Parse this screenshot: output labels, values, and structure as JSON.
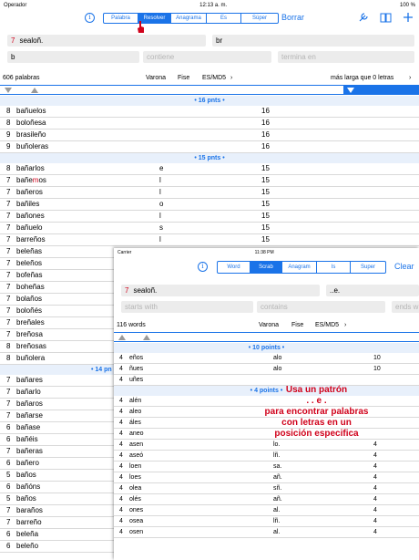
{
  "back": {
    "status": {
      "carrier": "Operador",
      "time": "12:13 a. m.",
      "battery": "100 %"
    },
    "nav": {
      "segments": [
        "Palabra",
        "Resolver",
        "Anagrama",
        "Es",
        "Súper"
      ],
      "active": 1,
      "right_link": "Borrar"
    },
    "inputs": {
      "letters_num": "7",
      "letters": "sealoñ.",
      "contains_letters": "br",
      "starts_with": "b",
      "contains_ph": "contiene",
      "ends_with_ph": "termina en"
    },
    "header": {
      "count": "606 palabras",
      "dict1": "Varona",
      "dict2": "Fise",
      "dict3": "ES/MD5",
      "longest": "más larga que 0 letras"
    },
    "sections": [
      {
        "title": "• 16 pnts •",
        "rows": [
          {
            "n": "8",
            "pre": "",
            "red": "",
            "post": "bañuelos",
            "x": "",
            "p": "16"
          },
          {
            "n": "8",
            "pre": "",
            "red": "",
            "post": "boloñesa",
            "x": "",
            "p": "16"
          },
          {
            "n": "9",
            "pre": "",
            "red": "",
            "post": "brasileño",
            "x": "",
            "p": "16"
          },
          {
            "n": "9",
            "pre": "",
            "red": "",
            "post": "buñoleras",
            "x": "",
            "p": "16"
          }
        ]
      },
      {
        "title": "• 15 pnts •",
        "rows": [
          {
            "n": "8",
            "pre": "bañarl",
            "red": "",
            "post": "os",
            "x": "e",
            "p": "15"
          },
          {
            "n": "7",
            "pre": "bañe",
            "red": "m",
            "post": "os",
            "x": "l",
            "p": "15"
          },
          {
            "n": "7",
            "pre": "bañer",
            "red": "",
            "post": "os",
            "x": "l",
            "p": "15"
          },
          {
            "n": "7",
            "pre": "bañil",
            "red": "",
            "post": "es",
            "x": "o",
            "p": "15"
          },
          {
            "n": "7",
            "pre": "bañon",
            "red": "",
            "post": "es",
            "x": "l",
            "p": "15"
          },
          {
            "n": "7",
            "pre": "bañue",
            "red": "",
            "post": "lo",
            "x": "s",
            "p": "15"
          },
          {
            "n": "7",
            "pre": "barre",
            "red": "",
            "post": "ños",
            "x": "l",
            "p": "15"
          },
          {
            "n": "7",
            "pre": "",
            "red": "",
            "post": "beleñas",
            "x": "",
            "p": ""
          },
          {
            "n": "7",
            "pre": "",
            "red": "",
            "post": "beleños",
            "x": "",
            "p": ""
          },
          {
            "n": "7",
            "pre": "",
            "red": "",
            "post": "bofeñas",
            "x": "",
            "p": ""
          },
          {
            "n": "7",
            "pre": "",
            "red": "",
            "post": "boheñas",
            "x": "",
            "p": ""
          },
          {
            "n": "7",
            "pre": "",
            "red": "",
            "post": "bolaños",
            "x": "",
            "p": ""
          },
          {
            "n": "7",
            "pre": "",
            "red": "",
            "post": "boloñés",
            "x": "",
            "p": ""
          },
          {
            "n": "7",
            "pre": "",
            "red": "",
            "post": "breñales",
            "x": "",
            "p": ""
          },
          {
            "n": "7",
            "pre": "",
            "red": "",
            "post": "breñosa",
            "x": "",
            "p": ""
          },
          {
            "n": "8",
            "pre": "",
            "red": "",
            "post": "breñosas",
            "x": "",
            "p": ""
          },
          {
            "n": "8",
            "pre": "",
            "red": "",
            "post": "buñolera",
            "x": "",
            "p": ""
          }
        ]
      },
      {
        "title": "• 14 pn",
        "rows": [
          {
            "n": "7",
            "pre": "",
            "red": "",
            "post": "bañares",
            "x": "",
            "p": ""
          },
          {
            "n": "7",
            "pre": "",
            "red": "",
            "post": "bañarlo",
            "x": "",
            "p": ""
          },
          {
            "n": "7",
            "pre": "",
            "red": "",
            "post": "bañaros",
            "x": "",
            "p": ""
          },
          {
            "n": "7",
            "pre": "",
            "red": "",
            "post": "bañarse",
            "x": "",
            "p": ""
          },
          {
            "n": "6",
            "pre": "",
            "red": "",
            "post": "bañase",
            "x": "",
            "p": ""
          },
          {
            "n": "6",
            "pre": "",
            "red": "",
            "post": "bañéis",
            "x": "",
            "p": ""
          },
          {
            "n": "7",
            "pre": "",
            "red": "",
            "post": "bañeras",
            "x": "",
            "p": ""
          },
          {
            "n": "6",
            "pre": "",
            "red": "",
            "post": "bañero",
            "x": "",
            "p": ""
          },
          {
            "n": "5",
            "pre": "",
            "red": "",
            "post": "baños",
            "x": "",
            "p": ""
          },
          {
            "n": "6",
            "pre": "",
            "red": "",
            "post": "bañóns",
            "x": "",
            "p": ""
          },
          {
            "n": "5",
            "pre": "",
            "red": "",
            "post": "baños",
            "x": "",
            "p": ""
          },
          {
            "n": "7",
            "pre": "",
            "red": "",
            "post": "baraños",
            "x": "",
            "p": ""
          },
          {
            "n": "7",
            "pre": "",
            "red": "",
            "post": "barreño",
            "x": "",
            "p": ""
          },
          {
            "n": "6",
            "pre": "",
            "red": "",
            "post": "beleña",
            "x": "",
            "p": ""
          },
          {
            "n": "6",
            "pre": "",
            "red": "",
            "post": "beleño",
            "x": "",
            "p": ""
          }
        ]
      }
    ]
  },
  "front": {
    "status": {
      "carrier": "Carrier",
      "time": "11:38 PM"
    },
    "nav": {
      "segments": [
        "Word",
        "Scrab",
        "Anagram",
        "Is",
        "Super"
      ],
      "active": 1,
      "right_link": "Clear"
    },
    "inputs": {
      "letters_num": "7",
      "letters": "sealoñ.",
      "pattern": "..e.",
      "starts_ph": "starts with",
      "contains_ph": "contains",
      "ends_ph": "ends w"
    },
    "header": {
      "count": "116 words",
      "dict1": "Varona",
      "dict2": "Fise",
      "dict3": "ES/MD5"
    },
    "sections": [
      {
        "title": "• 10 points •",
        "rows": [
          {
            "n": "4",
            "w": "eños",
            "x": "alo",
            "p": "10"
          },
          {
            "n": "4",
            "w": "ñues",
            "x": "alo",
            "p": "10"
          },
          {
            "n": "4",
            "w": "uñes",
            "x": "",
            "p": ""
          }
        ]
      },
      {
        "title": "• 4 points •",
        "rows": [
          {
            "n": "4",
            "w": "alén",
            "x": "",
            "p": ""
          },
          {
            "n": "4",
            "w": "aleo",
            "x": "",
            "p": ""
          },
          {
            "n": "4",
            "w": "áles",
            "x": "",
            "p": ""
          },
          {
            "n": "4",
            "w": "aneo",
            "x": "",
            "p": ""
          },
          {
            "n": "4",
            "w": "asen",
            "x": "lo.",
            "p": "4"
          },
          {
            "n": "4",
            "w": "aseó",
            "x": "lñ.",
            "p": "4"
          },
          {
            "n": "4",
            "w": "loen",
            "x": "sa.",
            "p": "4"
          },
          {
            "n": "4",
            "w": "loes",
            "x": "añ.",
            "p": "4"
          },
          {
            "n": "4",
            "w": "olea",
            "x": "sñ.",
            "p": "4"
          },
          {
            "n": "4",
            "w": "olés",
            "x": "añ.",
            "p": "4"
          },
          {
            "n": "4",
            "w": "ones",
            "x": "al.",
            "p": "4"
          },
          {
            "n": "4",
            "w": "osea",
            "x": "lñ.",
            "p": "4"
          },
          {
            "n": "4",
            "w": "osen",
            "x": "al.",
            "p": "4"
          }
        ]
      }
    ],
    "overlay": [
      "Usa un patrón",
      ". . e .",
      "para encontrar palabras",
      "con letras en un",
      "posición especifica"
    ]
  },
  "colors": {
    "accent": "#1a73e8",
    "highlight": "#d0021b"
  }
}
